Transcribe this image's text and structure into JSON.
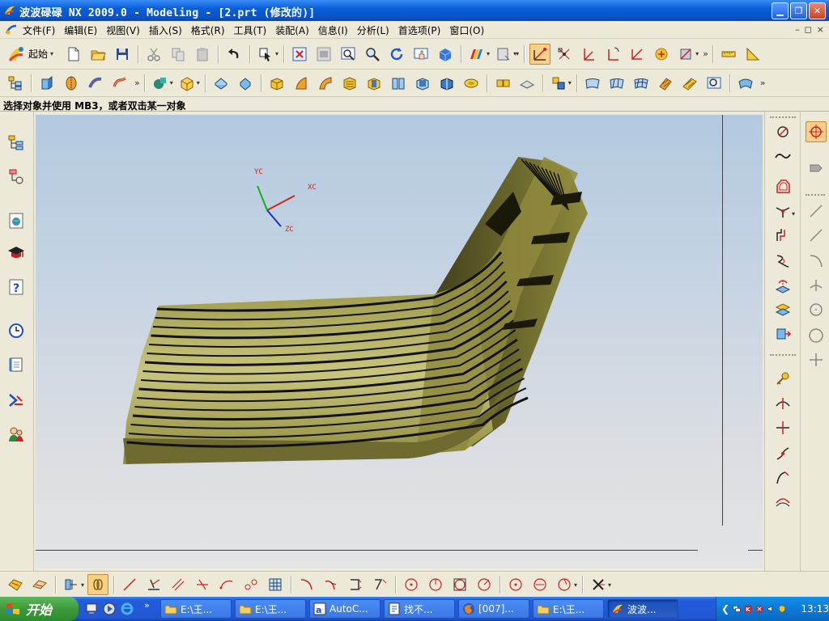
{
  "window": {
    "title": "波波碌碌 NX 2009.0 - Modeling - [2.prt (修改的)]",
    "controls": [
      "minimize",
      "restore",
      "close"
    ]
  },
  "menubar": {
    "items": [
      "文件(F)",
      "编辑(E)",
      "视图(V)",
      "插入(S)",
      "格式(R)",
      "工具(T)",
      "装配(A)",
      "信息(I)",
      "分析(L)",
      "首选项(P)",
      "窗口(O)"
    ],
    "mdi_controls": [
      "–",
      "◻",
      "×"
    ]
  },
  "toolbar": {
    "start_label": "起始",
    "start_dropdown": "▾",
    "overflow": "»"
  },
  "status": {
    "prompt": "选择对象并使用 MB3，或者双击某一对象"
  },
  "viewport": {
    "axis_labels": {
      "x": "XC",
      "y": "YC",
      "z": "ZC"
    },
    "colors": {
      "background_top": "#b3c9e0",
      "background_bottom": "#e4e4e4",
      "model": "#8e8a3c",
      "model_dark": "#3a3818",
      "stripe": "#111111",
      "axis_x": "#cc2a10",
      "axis_y": "#18b018",
      "axis_z": "#1830c8"
    }
  },
  "taskbar": {
    "start_label": "开始",
    "quick_more": "»",
    "tasks": [
      {
        "label": "E:\\王...",
        "icon": "folder-icon"
      },
      {
        "label": "E:\\王...",
        "icon": "folder-icon"
      },
      {
        "label": "AutoC...",
        "icon": "autocad-icon"
      },
      {
        "label": "找不...",
        "icon": "document-icon"
      },
      {
        "label": "[007]...",
        "icon": "firefox-icon"
      },
      {
        "label": "E:\\王...",
        "icon": "folder-icon"
      },
      {
        "label": "波波...",
        "icon": "nx-icon",
        "active": true
      }
    ],
    "clock": "13:13"
  }
}
